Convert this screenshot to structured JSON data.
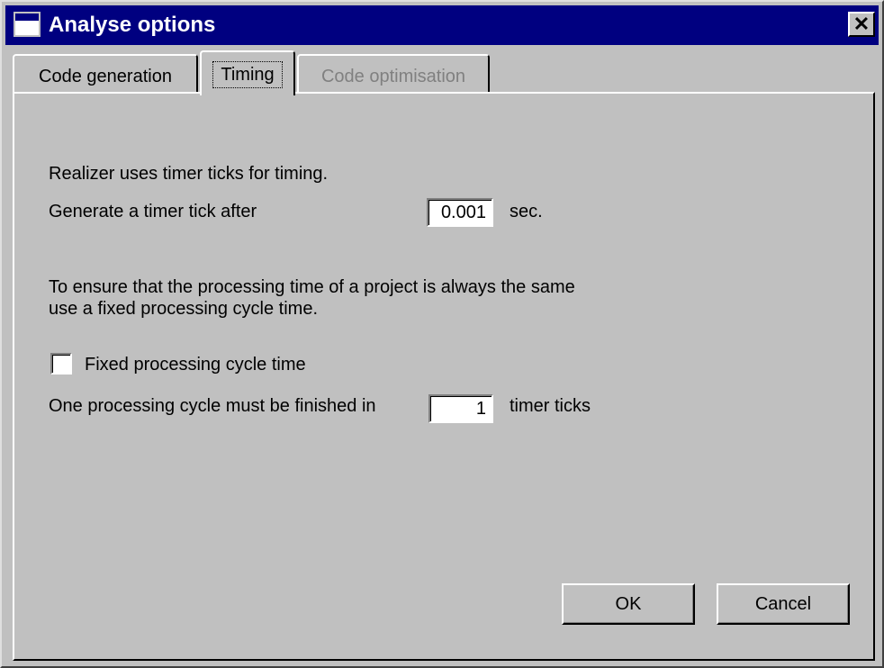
{
  "window": {
    "title": "Analyse options",
    "close_glyph": "✕"
  },
  "tabs": [
    {
      "label": "Code generation",
      "state": "normal"
    },
    {
      "label": "Timing",
      "state": "selected"
    },
    {
      "label": "Code optimisation",
      "state": "disabled"
    }
  ],
  "timing": {
    "intro": "Realizer uses timer ticks for timing.",
    "tick_label": "Generate a timer tick after",
    "tick_value": "0.001",
    "tick_unit": "sec.",
    "desc_line1": "To ensure that the processing time of a project is always the same",
    "desc_line2": "use a fixed processing cycle time.",
    "fixed_checkbox_label": "Fixed processing cycle time",
    "fixed_checked": false,
    "cycle_label": "One processing cycle must be finished in",
    "cycle_value": "1",
    "cycle_unit": "timer ticks"
  },
  "buttons": {
    "ok": "OK",
    "cancel": "Cancel"
  },
  "colors": {
    "titlebar": "#000080",
    "face": "#c0c0c0",
    "disabled_text": "#808080"
  },
  "icons": [
    "window-icon",
    "close-icon"
  ]
}
